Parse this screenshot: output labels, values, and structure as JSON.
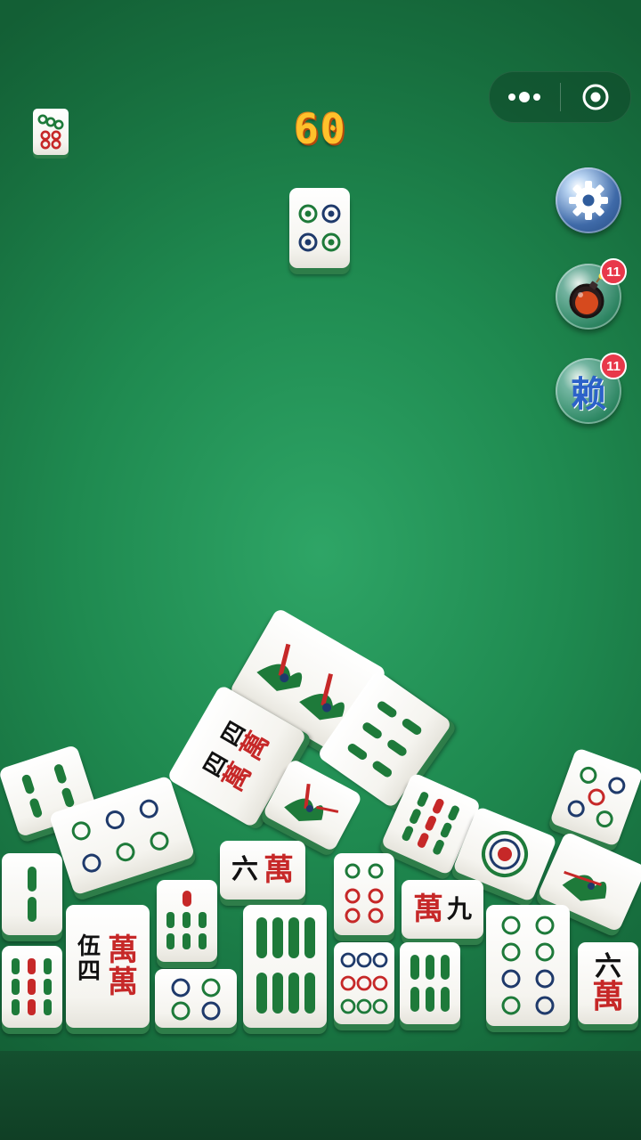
{
  "hud": {
    "score": "60",
    "menu_icon": "more-dots-icon",
    "close_icon": "target-circle-icon"
  },
  "powerups": {
    "settings": {
      "icon": "gear-icon"
    },
    "bomb": {
      "icon": "bomb-icon",
      "count": "11"
    },
    "wildcard": {
      "icon": "lai-character-icon",
      "label": "赖",
      "count": "11"
    }
  },
  "tiles": {
    "next_preview": {
      "suit": "circles",
      "rank": 6
    },
    "falling": {
      "suit": "circles",
      "rank": 4
    },
    "chars": {
      "liu": "六",
      "si": "四",
      "jiu": "九",
      "wu": "伍",
      "wan": "萬"
    }
  },
  "colors": {
    "felt": "#1f8a50",
    "tile_face": "#f5f4ef",
    "red": "#c62828",
    "green": "#1e7a3a",
    "blue": "#1f3a6b",
    "score": "#ffc12b"
  }
}
